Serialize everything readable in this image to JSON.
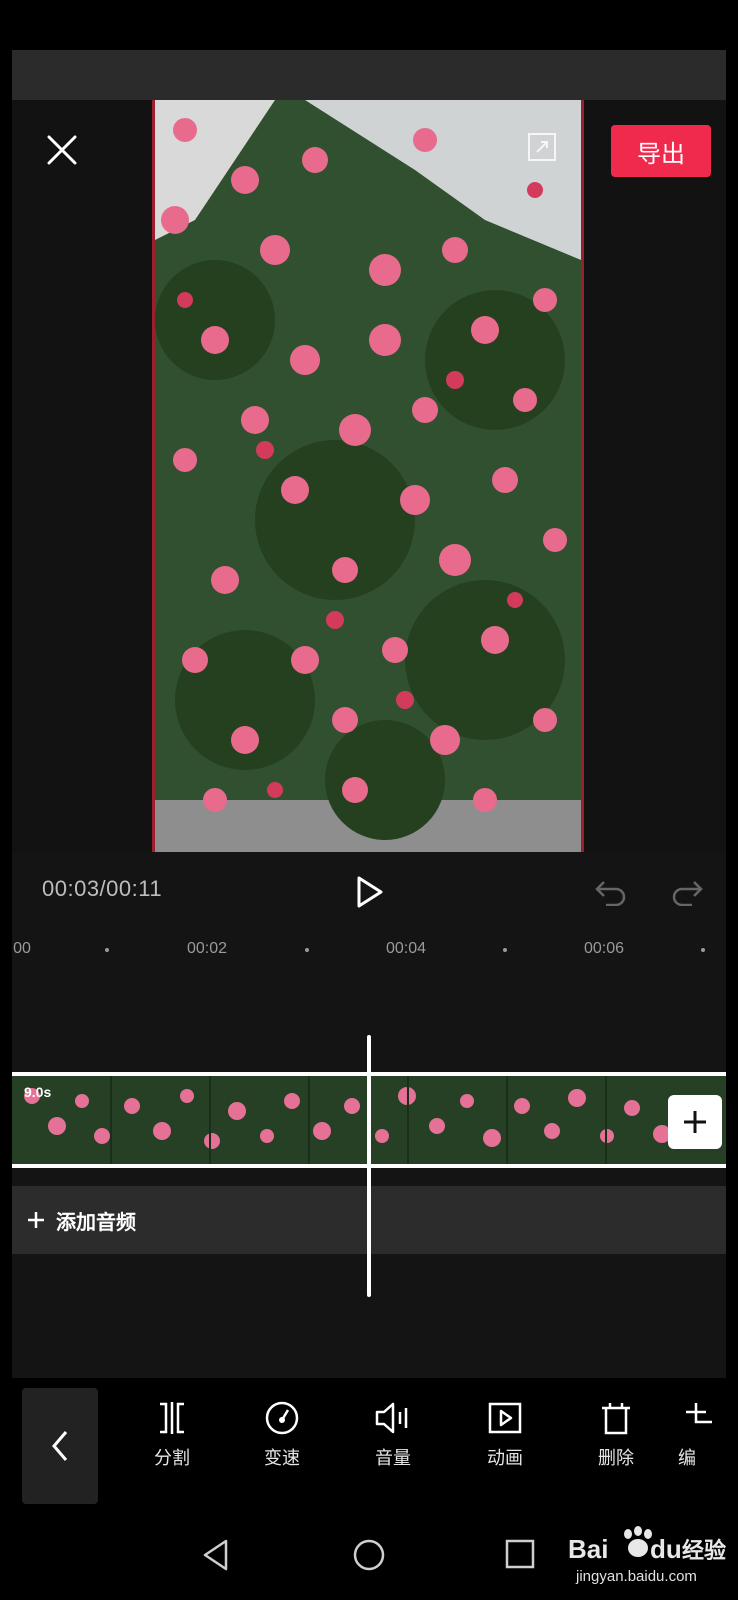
{
  "header": {
    "close_icon": "close-icon",
    "expand_icon": "fullscreen-icon",
    "export_label": "导出",
    "accent": "#f02a4d"
  },
  "player": {
    "time": "00:03/00:11",
    "play_icon": "play-icon",
    "undo_icon": "undo-icon",
    "redo_icon": "redo-icon"
  },
  "ruler": {
    "labels": [
      "00",
      "00:02",
      "00:04",
      "00:06"
    ]
  },
  "timeline": {
    "clip_duration": "9.0s",
    "add_clip_icon": "plus-icon",
    "audio_label": "添加音频"
  },
  "toolbar": {
    "back_icon": "chevron-left-icon",
    "items": [
      {
        "label": "分割",
        "icon": "split-icon"
      },
      {
        "label": "变速",
        "icon": "speed-icon"
      },
      {
        "label": "音量",
        "icon": "volume-icon"
      },
      {
        "label": "动画",
        "icon": "animation-icon"
      },
      {
        "label": "删除",
        "icon": "delete-icon"
      },
      {
        "label": "编",
        "icon": "edit-icon"
      }
    ]
  },
  "watermark": {
    "brand": "Bai du 经验",
    "url": "jingyan.baidu.com"
  }
}
